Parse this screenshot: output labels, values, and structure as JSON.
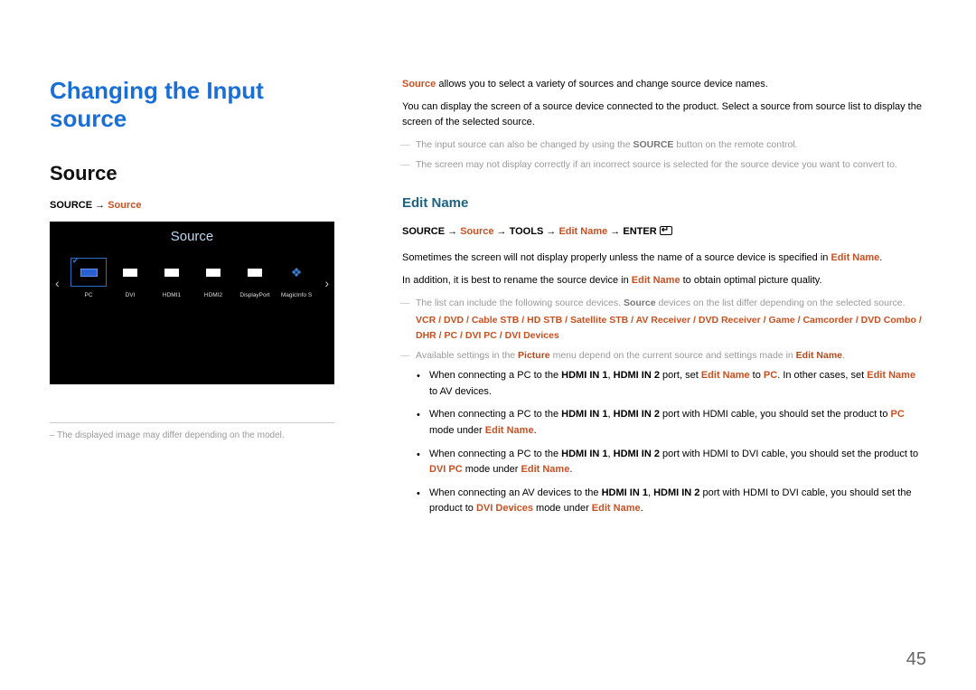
{
  "title": "Changing the Input source",
  "section": "Source",
  "left": {
    "path_source": "SOURCE",
    "path_src2": "Source",
    "scr_title": "Source",
    "tiles": [
      "PC",
      "DVI",
      "HDMI1",
      "HDMI2",
      "DisplayPort",
      "MagicInfo S"
    ],
    "caption": "The displayed image may differ depending on the model."
  },
  "right": {
    "intro1a": "Source",
    "intro1b": " allows you to select a variety of sources and change source device names.",
    "intro2": "You can display the screen of a source device connected to the product. Select a source from source list to display the screen of the selected source.",
    "note1a": "The input source can also be changed by using the ",
    "note1b": "SOURCE",
    "note1c": " button on the remote control.",
    "note2": "The screen may not display correctly if an incorrect source is selected for the source device you want to convert to.",
    "sub": "Edit Name",
    "path2_a": "SOURCE",
    "path2_b": "Source",
    "path2_c": "TOOLS",
    "path2_d": "Edit Name",
    "path2_e": "ENTER",
    "p1a": "Sometimes the screen will not display properly unless the name of a source device is specified in ",
    "p1b": "Edit Name",
    "p1c": ".",
    "p2a": "In addition, it is best to rename the source device in ",
    "p2b": "Edit Name",
    "p2c": " to obtain optimal picture quality.",
    "note3a": "The list can include the following source devices. ",
    "note3b": "Source",
    "note3c": " devices on the list differ depending on the selected source.",
    "devices": [
      "VCR",
      "DVD",
      "Cable STB",
      "HD STB",
      "Satellite STB",
      "AV Receiver",
      "DVD Receiver",
      "Game",
      "Camcorder",
      "DVD Combo",
      "DHR",
      "PC",
      "DVI PC",
      "DVI Devices"
    ],
    "note4a": "Available settings in the ",
    "note4b": "Picture",
    "note4c": " menu depend on the current source and settings made in ",
    "note4d": "Edit Name",
    "note4e": ".",
    "b1a": "When connecting a PC to the ",
    "b1b": "HDMI IN 1",
    "b1c": "HDMI IN 2",
    "b1d": " port, set ",
    "b1e": "Edit Name",
    "b1f": " to ",
    "b1g": "PC",
    "b1h": ". In other cases, set ",
    "b1i": "Edit Name",
    "b1j": " to AV devices.",
    "b2a": "When connecting a PC to the ",
    "b2b": "HDMI IN 1",
    "b2c": "HDMI IN 2",
    "b2d": " port with HDMI cable, you should set the product to ",
    "b2e": "PC",
    "b2f": " mode under ",
    "b2g": "Edit Name",
    "b2h": ".",
    "b3a": "When connecting a PC to the ",
    "b3b": "HDMI IN 1",
    "b3c": "HDMI IN 2",
    "b3d": " port with HDMI to DVI cable, you should set the product to ",
    "b3e": "DVI PC",
    "b3f": " mode under ",
    "b3g": "Edit Name",
    "b3h": ".",
    "b4a": "When connecting an AV devices to the ",
    "b4b": "HDMI IN 1",
    "b4c": "HDMI IN 2",
    "b4d": " port with HDMI to DVI cable, you should set the product to ",
    "b4e": "DVI Devices",
    "b4f": " mode under ",
    "b4g": "Edit Name",
    "b4h": "."
  },
  "page_num": "45"
}
